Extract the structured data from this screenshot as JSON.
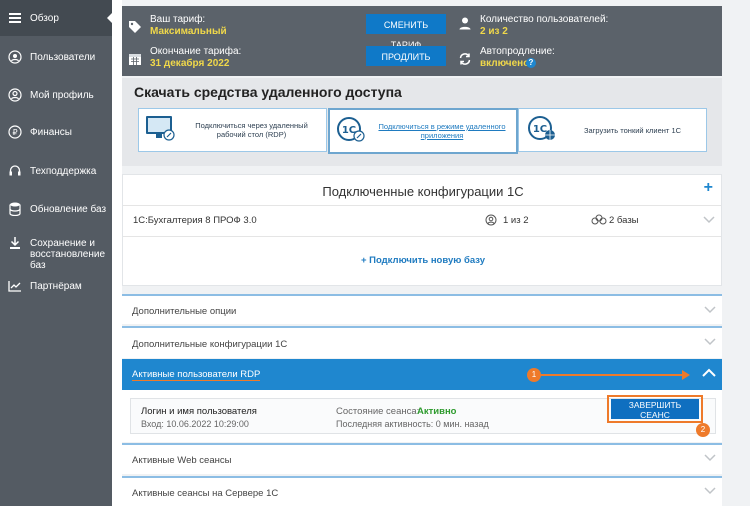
{
  "sidebar": {
    "items": [
      {
        "label": "Обзор",
        "icon": "menu-icon"
      },
      {
        "label": "Пользователи",
        "icon": "users-icon"
      },
      {
        "label": "Мой профиль",
        "icon": "profile-icon"
      },
      {
        "label": "Финансы",
        "icon": "ruble-icon"
      },
      {
        "label": "Техподдержка",
        "icon": "headset-icon"
      },
      {
        "label": "Обновление баз",
        "icon": "database-icon"
      },
      {
        "label": "Сохранение и восстановление баз",
        "icon": "download-icon"
      },
      {
        "label": "Партнёрам",
        "icon": "chart-icon"
      }
    ]
  },
  "tariff": {
    "plan_label": "Ваш тариф:",
    "plan_value": "Максимальный",
    "end_label": "Окончание тарифа:",
    "end_value": "31 декабря 2022",
    "change_button": "СМЕНИТЬ ТАРИФ",
    "extend_button": "ПРОДЛИТЬ",
    "users_label": "Количество пользователей:",
    "users_value": "2 из 2",
    "autorenew_label": "Автопродление:",
    "autorenew_value": "включено",
    "help": "?"
  },
  "remote": {
    "title": "Скачать средства удаленного доступа",
    "rdp_card": "Подключиться через удаленный рабочий стол (RDP)",
    "app_card": "Подключиться в режиме удаленного приложения",
    "thin_card": "Загрузить тонкий клиент 1С"
  },
  "configs": {
    "title": "Подключенные конфигурации 1С",
    "add_icon": "+",
    "row_name": "1С:Бухгалтерия 8 ПРОФ 3.0",
    "row_users": "1 из 2",
    "row_bases": "2 базы",
    "connect_link": "+ Подключить новую базу"
  },
  "sections": {
    "additional_options": "Дополнительные опции",
    "additional_configs": "Дополнительные конфигурации 1С",
    "active_rdp": "Активные пользователи RDP",
    "active_web": "Активные Web сеансы",
    "active_server": "Активные сеансы на Сервере 1С"
  },
  "session": {
    "user_label": "Логин и имя пользователя",
    "login_time": "Вход: 10.06.2022 10:29:00",
    "state_label": "Состояние сеанса:",
    "state_value": "Активно",
    "last_activity": "Последняя активность: 0 мин. назад",
    "end_button": "ЗАВЕРШИТЬ СЕАНС"
  },
  "annotations": {
    "badge1": "1",
    "badge2": "2"
  },
  "colors": {
    "accent": "#1f87cf",
    "highlight": "#ee7a2a",
    "sidebar": "#545b63",
    "active": "#2e9b2e"
  }
}
